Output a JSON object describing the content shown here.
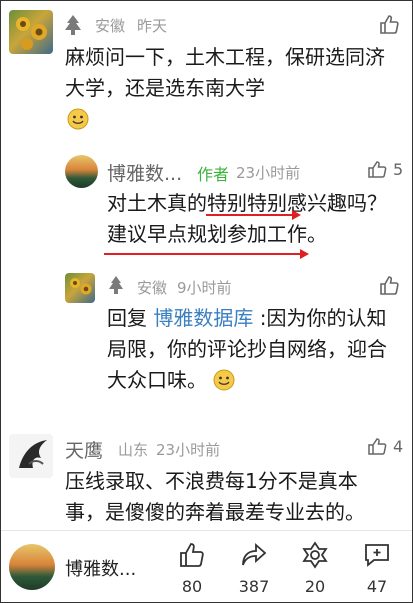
{
  "comment1": {
    "region": "安徽",
    "time": "昨天",
    "text_line1": "麻烦问一下，土木工程，保研选同济",
    "text_line2": "大学，还是选东南大学"
  },
  "reply1": {
    "name": "博雅数...",
    "author_tag": "作者",
    "time": "23小时前",
    "likes": "5",
    "text_line1": "对土木真的特别特别感兴趣吗？",
    "text_line2": "建议早点规划参加工作。"
  },
  "reply2": {
    "region": "安徽",
    "time": "9小时前",
    "reply_prefix": "回复",
    "reply_target": "博雅数据库",
    "text_line1_rest": ":因为你的认知",
    "text_line2": "局限，你的评论抄自网络，迎合",
    "text_line3": "大众口味。"
  },
  "comment2": {
    "name": "天鹰",
    "region": "山东",
    "time": "23小时前",
    "likes": "4",
    "text_line1": "压线录取、不浪费每1分不是真本",
    "text_line2": "事，是傻傻的奔着最差专业去的。"
  },
  "bottom": {
    "name": "博雅数...",
    "like_count": "80",
    "share_count": "387",
    "collect_count": "20",
    "comment_count": "47"
  },
  "colors": {
    "link": "#3a7fc1",
    "author_tag": "#3db33d",
    "annotation_arrow": "#e02020"
  }
}
